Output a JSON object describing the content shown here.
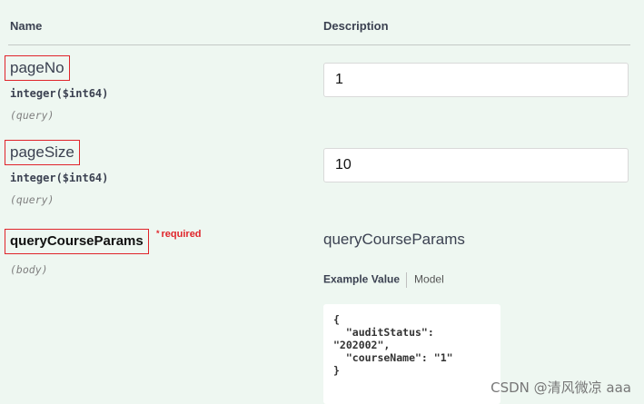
{
  "headers": {
    "name": "Name",
    "description": "Description"
  },
  "params": [
    {
      "name": "pageNo",
      "type": "integer($int64)",
      "in": "(query)",
      "value": "1"
    },
    {
      "name": "pageSize",
      "type": "integer($int64)",
      "in": "(query)",
      "value": "10"
    },
    {
      "name": "queryCourseParams",
      "in": "(body)",
      "required": "required",
      "required_mark": "*",
      "schema_title": "queryCourseParams"
    }
  ],
  "tabs": {
    "example": "Example Value",
    "model": "Model"
  },
  "example_json": "{\n  \"auditStatus\":\n\"202002\",\n  \"courseName\": \"1\"\n}",
  "watermark": "CSDN @清风微凉 aaa",
  "colors": {
    "panel": "#eef7f1",
    "highlight_border": "#e0242a",
    "required": "#e0242a"
  }
}
